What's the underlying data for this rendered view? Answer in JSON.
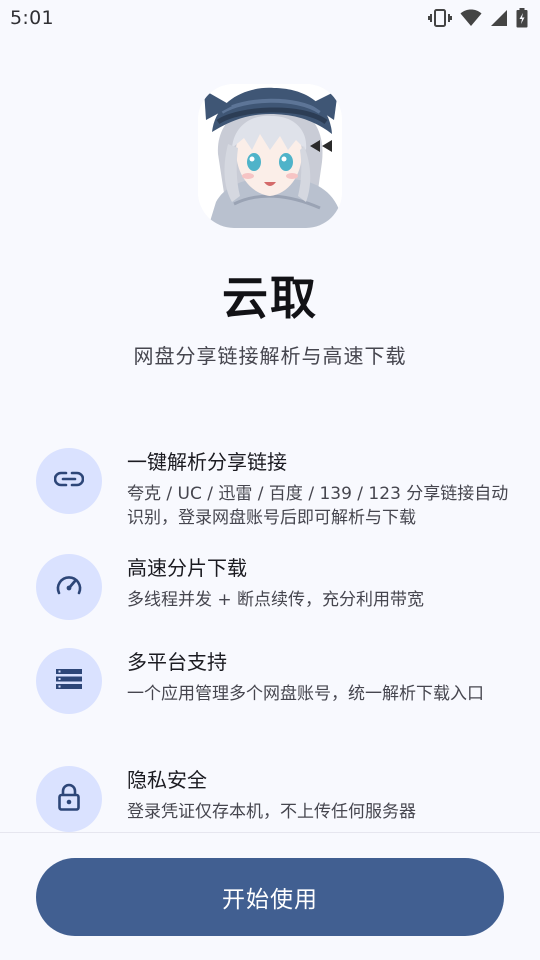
{
  "status_bar": {
    "time": "5:01",
    "icons": [
      "vibrate-icon",
      "wifi-icon",
      "signal-icon",
      "battery-charging-icon"
    ]
  },
  "app": {
    "name": "云取",
    "tagline": "网盘分享链接解析与高速下载",
    "icon": "anime-girl-app-icon"
  },
  "features": [
    {
      "icon": "link-icon",
      "title": "一键解析分享链接",
      "description": "夸克 / UC / 迅雷 / 百度 / 139 / 123 分享链接自动识别，登录网盘账号后即可解析与下载"
    },
    {
      "icon": "speedometer-icon",
      "title": "高速分片下载",
      "description": "多线程并发 + 断点续传，充分利用带宽"
    },
    {
      "icon": "storage-icon",
      "title": "多平台支持",
      "description": "一个应用管理多个网盘账号，统一解析下载入口"
    },
    {
      "icon": "lock-icon",
      "title": "隐私安全",
      "description": "登录凭证仅存本机，不上传任何服务器"
    }
  ],
  "actions": {
    "start_label": "开始使用"
  },
  "colors": {
    "background": "#f8f9fe",
    "primary": "#415f91",
    "icon_circle": "#dae2ff",
    "icon_glyph": "#2d4678"
  }
}
